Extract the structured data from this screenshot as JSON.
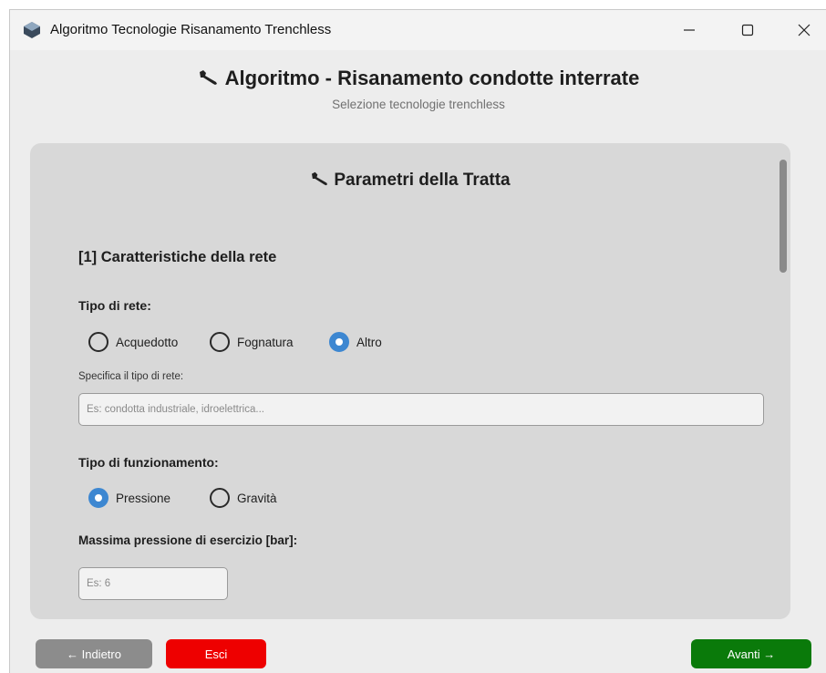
{
  "window": {
    "title": "Algoritmo Tecnologie Risanamento Trenchless",
    "controls": {
      "minimize": "minimize-icon",
      "maximize": "maximize-icon",
      "close": "close-icon"
    }
  },
  "header": {
    "icon": "wrench-icon",
    "title": "Algoritmo - Risanamento condotte interrate",
    "subtitle": "Selezione tecnologie trenchless"
  },
  "card": {
    "icon": "wrench-icon",
    "title": "Parametri della Tratta",
    "section_title": "[1] Caratteristiche della rete",
    "tipo_rete": {
      "label": "Tipo di rete:",
      "options": [
        "Acquedotto",
        "Fognatura",
        "Altro"
      ],
      "selected": "Altro"
    },
    "specifica": {
      "label": "Specifica il tipo di rete:",
      "placeholder": "Es: condotta industriale, idroelettrica...",
      "value": ""
    },
    "tipo_funzionamento": {
      "label": "Tipo di funzionamento:",
      "options": [
        "Pressione",
        "Gravità"
      ],
      "selected": "Pressione"
    },
    "pressione": {
      "label": "Massima pressione di esercizio [bar]:",
      "placeholder": "Es: 6",
      "value": ""
    }
  },
  "footer": {
    "back_label": "← Indietro",
    "exit_label": "Esci",
    "next_label": "Avanti →"
  },
  "colors": {
    "accent": "#3d87d1",
    "exit": "#ee0000",
    "next": "#0a7a0a",
    "back": "#8c8c8c"
  }
}
